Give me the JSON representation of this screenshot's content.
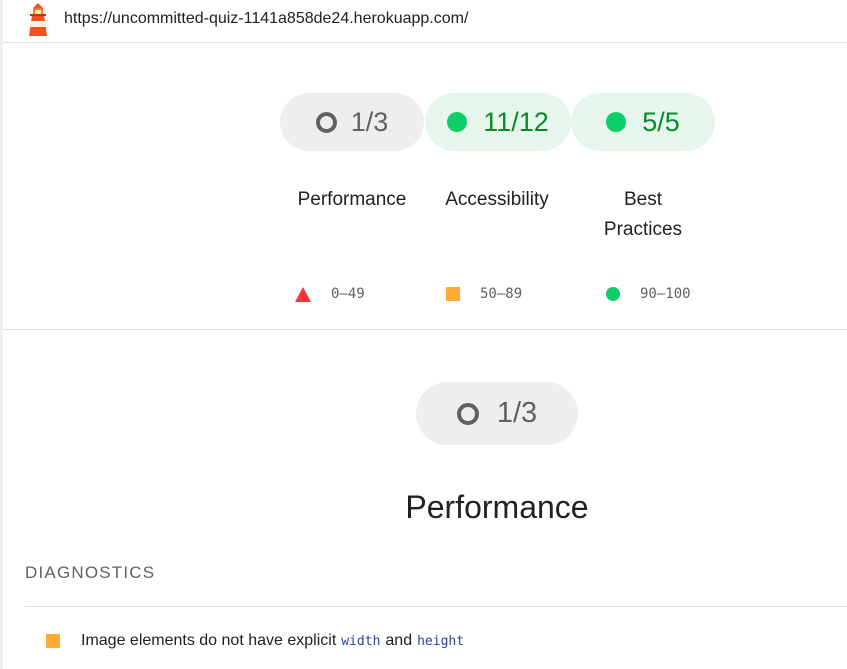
{
  "header": {
    "url": "https://uncommitted-quiz-1141a858de24.herokuapp.com/",
    "logo_icon": "lighthouse-icon"
  },
  "summary": {
    "categories": [
      {
        "id": "performance",
        "score": "1/3",
        "label": "Performance",
        "status": "fail",
        "icon": "ring-icon"
      },
      {
        "id": "accessibility",
        "score": "11/12",
        "label": "Accessibility",
        "status": "pass",
        "icon": "green-dot-icon"
      },
      {
        "id": "best-practices",
        "score": "5/5",
        "label_line1": "Best",
        "label_line2": "Practices",
        "status": "pass",
        "icon": "green-dot-icon"
      }
    ]
  },
  "legend": [
    {
      "range": "0–49",
      "icon": "red-triangle-icon",
      "color": "#ff3333"
    },
    {
      "range": "50–89",
      "icon": "orange-square-icon",
      "color": "#ffaa33"
    },
    {
      "range": "90–100",
      "icon": "green-circle-icon",
      "color": "#0cce6b"
    }
  ],
  "category_section": {
    "score": "1/3",
    "title": "Performance",
    "group_title": "DIAGNOSTICS",
    "audits": [
      {
        "text_before": "Image elements do not have explicit",
        "code1": "width",
        "text_middle": "and",
        "code2": "height",
        "icon": "orange-square-icon"
      }
    ]
  },
  "colors": {
    "pass_text": "#0a8a2a",
    "pass_bg": "#e6f6ed",
    "neutral_bg": "#eeeeee",
    "fail": "#ff3333",
    "average": "#ffaa33",
    "pass": "#0cce6b",
    "code": "#303f9f"
  }
}
